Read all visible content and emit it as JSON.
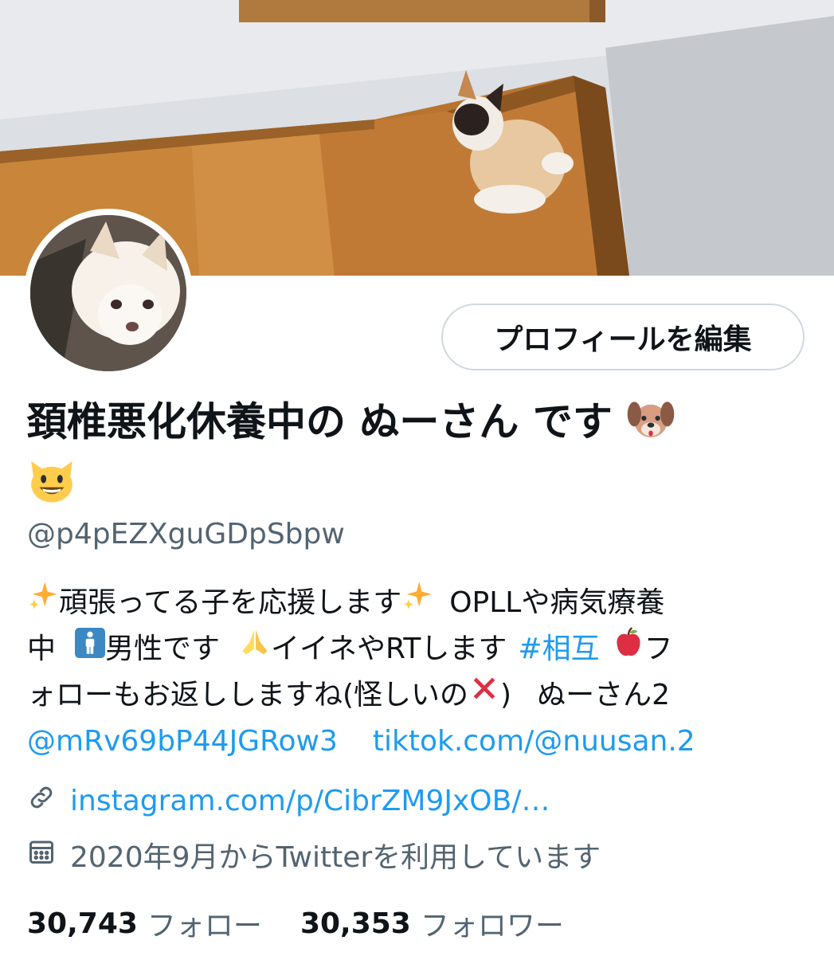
{
  "profile": {
    "name": "頚椎悪化休養中の ぬーさん です",
    "handle": "@p4pEZXguGDpSbpw",
    "edit_button": "プロフィールを編集",
    "bio": {
      "line1_a": "頑張ってる子を応援します",
      "line1_b": "OPLLや病気療養",
      "line2_a": "中",
      "line2_b": "男性です",
      "line2_c": "イイネやRTします",
      "line2_hashtag": "#相互",
      "line2_d": "フ",
      "line3_a": "ォローもお返ししますね(怪しいの",
      "line3_b": ")",
      "line3_c": "ぬーさん2",
      "mention": "@mRv69bP44JGRow3",
      "tiktok": "tiktok.com/@nuusan.2"
    },
    "website": "instagram.com/p/CibrZM9JxOB/…",
    "joined": "2020年9月からTwitterを利用しています",
    "following_count": "30,743",
    "following_label": "フォロー",
    "followers_count": "30,353",
    "followers_label": "フォロワー"
  },
  "icons": [
    "dog-face-icon",
    "cat-face-icon",
    "sparkles-icon",
    "man-symbol-icon",
    "folded-hands-icon",
    "apple-icon",
    "cross-mark-icon",
    "link-icon",
    "calendar-icon"
  ],
  "colors": {
    "link": "#1d9bf0",
    "text": "#0f1419",
    "secondary": "#536471",
    "border": "#cfd9de"
  }
}
